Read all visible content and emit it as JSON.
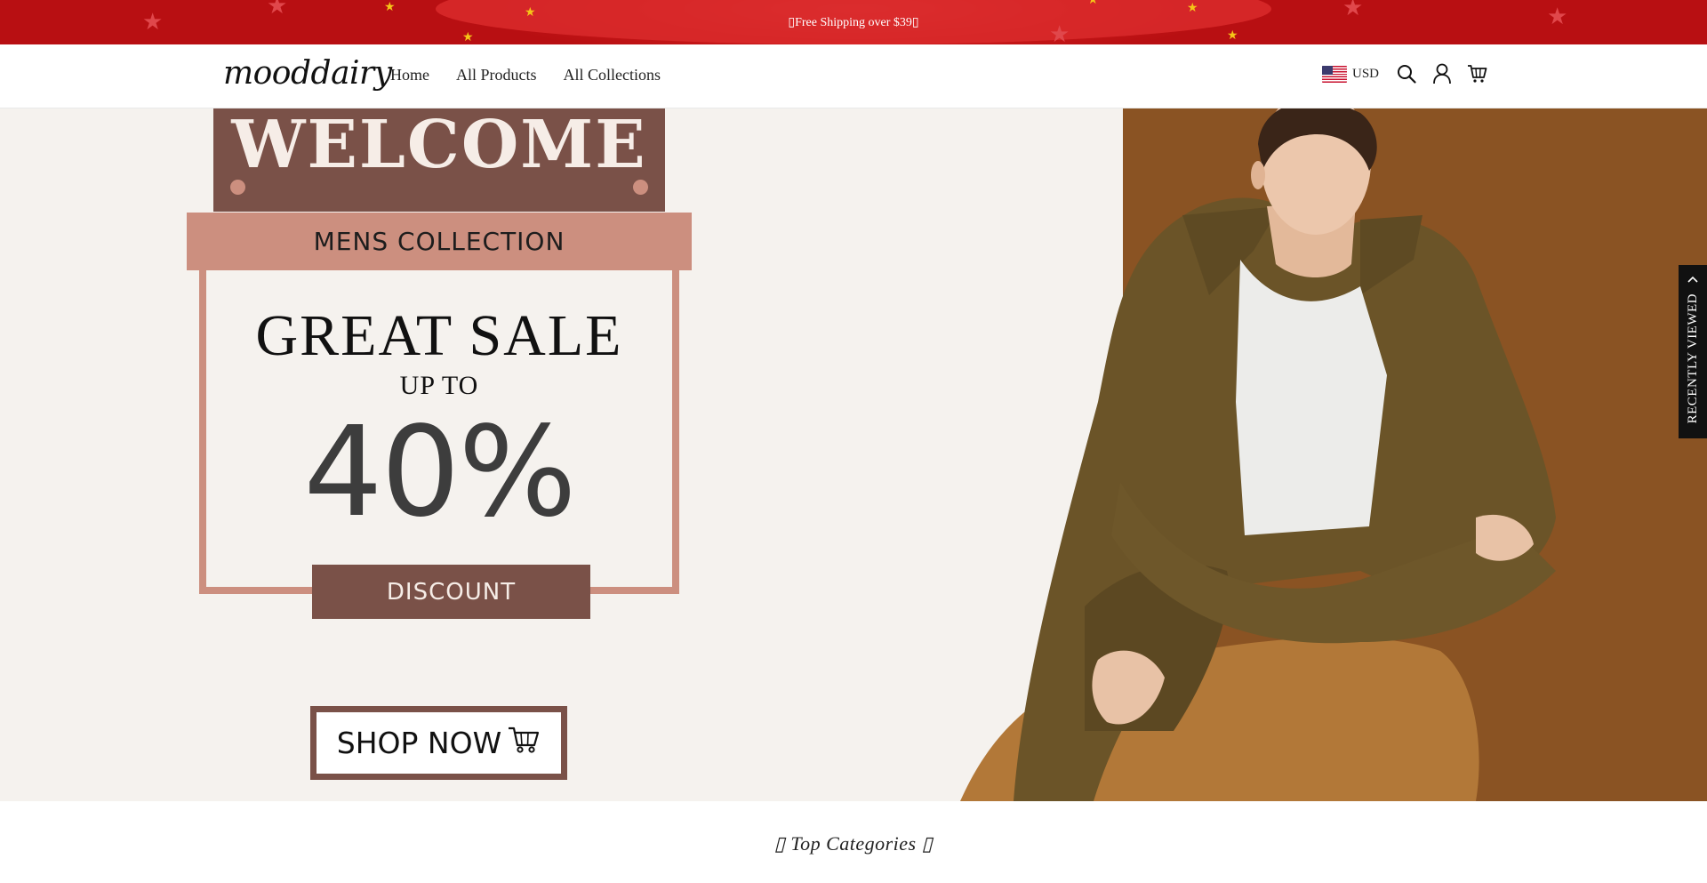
{
  "announcement": {
    "text": "▯Free Shipping over $39▯"
  },
  "header": {
    "logo": "mooddairy",
    "nav": [
      {
        "label": "Home"
      },
      {
        "label": "All Products"
      },
      {
        "label": "All Collections"
      }
    ],
    "currency": "USD",
    "icons": [
      "us-flag-icon",
      "search-icon",
      "account-icon",
      "cart-icon"
    ]
  },
  "hero": {
    "welcome": "WELCOME",
    "collection": "MENS COLLECTION",
    "headline": "GREAT SALE",
    "up_to": "UP TO",
    "percent": "40%",
    "discount": "DISCOUNT",
    "cta": "SHOP NOW"
  },
  "recently_viewed": {
    "label": "RECENTLY VIEWED"
  },
  "section": {
    "title": "▯ Top Categories ▯"
  },
  "colors": {
    "announcement_red": "#cc1b1b",
    "brown": "#7a5148",
    "rose": "#cc8f7f",
    "hero_bg": "#f5f2ee",
    "photo_bg": "#8a5323"
  }
}
